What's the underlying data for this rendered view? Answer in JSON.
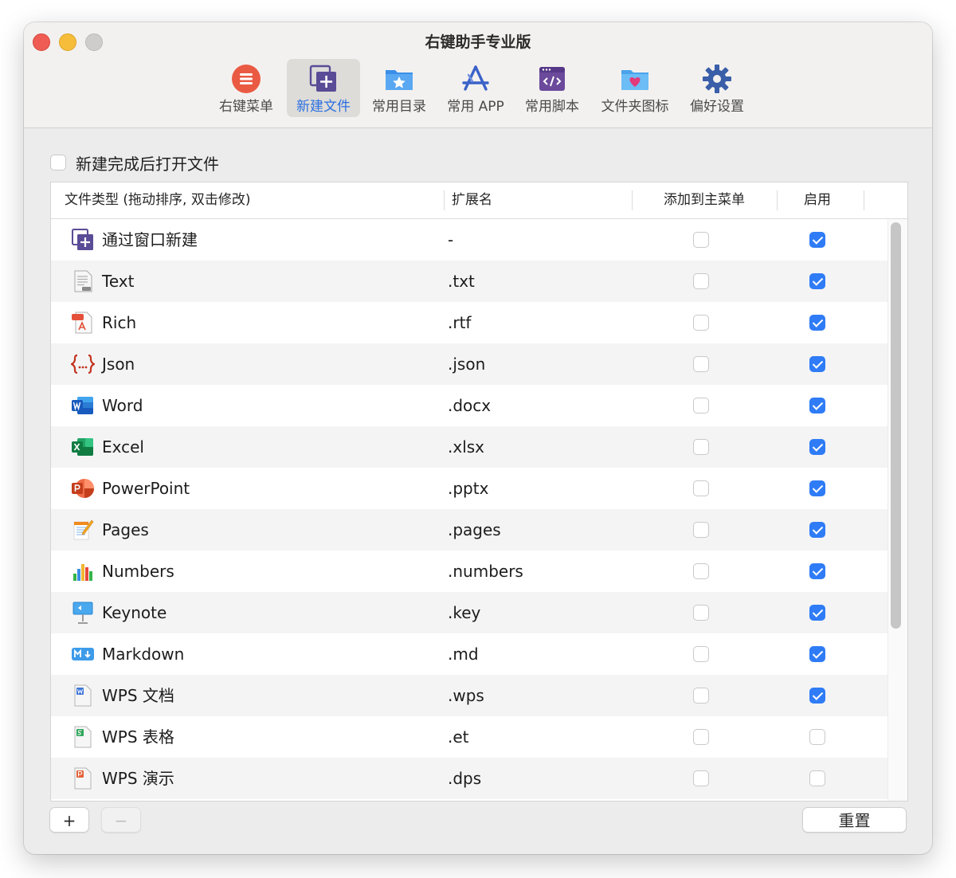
{
  "window": {
    "title": "右键助手专业版"
  },
  "toolbar": {
    "items": [
      {
        "label": "右键菜单",
        "icon": "menu-list-icon",
        "selected": false
      },
      {
        "label": "新建文件",
        "icon": "new-file-icon",
        "selected": true
      },
      {
        "label": "常用目录",
        "icon": "star-folder-icon",
        "selected": false
      },
      {
        "label": "常用 APP",
        "icon": "app-store-icon",
        "selected": false
      },
      {
        "label": "常用脚本",
        "icon": "script-icon",
        "selected": false
      },
      {
        "label": "文件夹图标",
        "icon": "heart-folder-icon",
        "selected": false
      },
      {
        "label": "偏好设置",
        "icon": "gear-icon",
        "selected": false
      }
    ]
  },
  "options": {
    "open_after_create_label": "新建完成后打开文件",
    "open_after_create_checked": false
  },
  "table": {
    "headers": {
      "type": "文件类型 (拖动排序, 双击修改)",
      "ext": "扩展名",
      "add_to_main": "添加到主菜单",
      "enabled": "启用"
    },
    "rows": [
      {
        "name": "通过窗口新建",
        "ext": "-",
        "icon": "new-window-icon",
        "main": false,
        "enabled": true
      },
      {
        "name": "Text",
        "ext": ".txt",
        "icon": "text-file-icon",
        "main": false,
        "enabled": true
      },
      {
        "name": "Rich",
        "ext": ".rtf",
        "icon": "rtf-file-icon",
        "main": false,
        "enabled": true
      },
      {
        "name": "Json",
        "ext": ".json",
        "icon": "json-file-icon",
        "main": false,
        "enabled": true
      },
      {
        "name": "Word",
        "ext": ".docx",
        "icon": "word-icon",
        "main": false,
        "enabled": true
      },
      {
        "name": "Excel",
        "ext": ".xlsx",
        "icon": "excel-icon",
        "main": false,
        "enabled": true
      },
      {
        "name": "PowerPoint",
        "ext": ".pptx",
        "icon": "powerpoint-icon",
        "main": false,
        "enabled": true
      },
      {
        "name": "Pages",
        "ext": ".pages",
        "icon": "pages-icon",
        "main": false,
        "enabled": true
      },
      {
        "name": "Numbers",
        "ext": ".numbers",
        "icon": "numbers-icon",
        "main": false,
        "enabled": true
      },
      {
        "name": "Keynote",
        "ext": ".key",
        "icon": "keynote-icon",
        "main": false,
        "enabled": true
      },
      {
        "name": "Markdown",
        "ext": ".md",
        "icon": "markdown-icon",
        "main": false,
        "enabled": true
      },
      {
        "name": "WPS 文档",
        "ext": ".wps",
        "icon": "wps-writer-icon",
        "main": false,
        "enabled": true
      },
      {
        "name": "WPS 表格",
        "ext": ".et",
        "icon": "wps-sheet-icon",
        "main": false,
        "enabled": false
      },
      {
        "name": "WPS 演示",
        "ext": ".dps",
        "icon": "wps-slides-icon",
        "main": false,
        "enabled": false
      }
    ]
  },
  "footer": {
    "add_label": "+",
    "remove_label": "−",
    "reset_label": "重置"
  },
  "colors": {
    "accent": "#2f7cf6",
    "selected_tab_text": "#2a6fe0"
  }
}
